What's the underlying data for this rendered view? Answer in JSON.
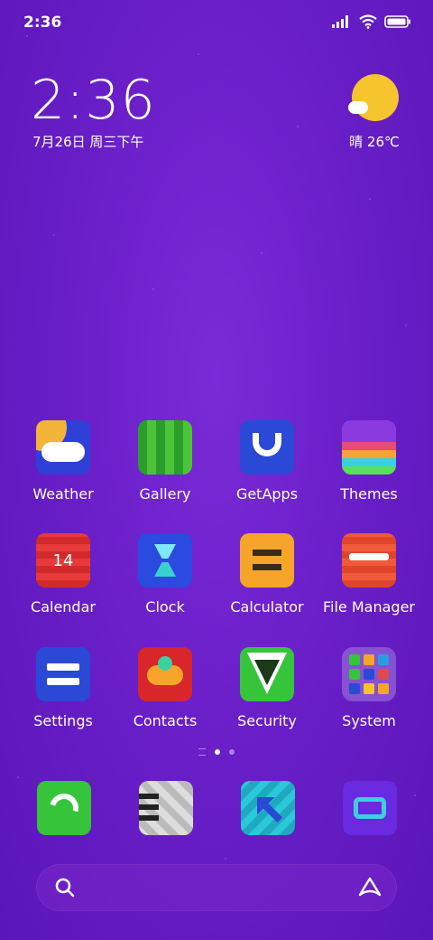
{
  "status_bar": {
    "time": "2:36"
  },
  "clock_widget": {
    "time": "2:36",
    "date": "7月26日 周三下午"
  },
  "weather_widget": {
    "condition_temp": "晴 26℃",
    "icon": "sunny-cloud-icon"
  },
  "apps": [
    {
      "label": "Weather",
      "icon": "weather-icon"
    },
    {
      "label": "Gallery",
      "icon": "gallery-icon"
    },
    {
      "label": "GetApps",
      "icon": "getapps-icon"
    },
    {
      "label": "Themes",
      "icon": "themes-icon"
    },
    {
      "label": "Calendar",
      "icon": "calendar-icon",
      "badge": "14"
    },
    {
      "label": "Clock",
      "icon": "clock-icon"
    },
    {
      "label": "Calculator",
      "icon": "calculator-icon"
    },
    {
      "label": "File Manager",
      "icon": "file-manager-icon"
    },
    {
      "label": "Settings",
      "icon": "settings-icon"
    },
    {
      "label": "Contacts",
      "icon": "contacts-icon"
    },
    {
      "label": "Security",
      "icon": "security-icon"
    },
    {
      "label": "System",
      "icon": "folder-icon"
    }
  ],
  "page_indicator": {
    "pages": 2,
    "active": 1
  },
  "dock": [
    {
      "icon": "phone-icon"
    },
    {
      "icon": "messages-icon"
    },
    {
      "icon": "browser-icon"
    },
    {
      "icon": "camera-icon"
    }
  ],
  "search_bar": {
    "search_icon": "search-icon",
    "assistant_icon": "assistant-icon"
  }
}
